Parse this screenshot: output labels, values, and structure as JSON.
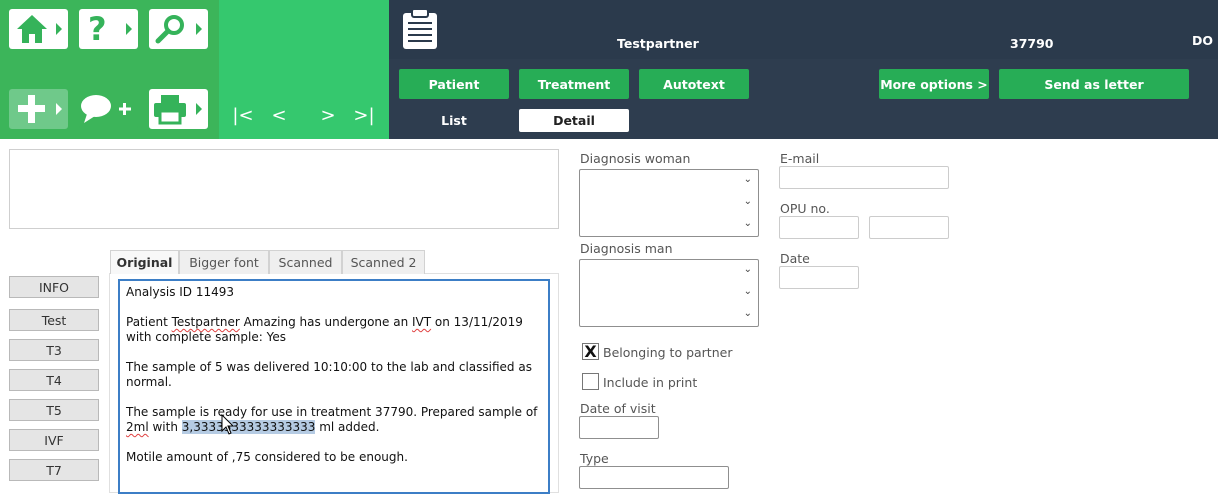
{
  "toolbar": {
    "home_icon": "home-icon",
    "help_icon": "question-icon",
    "search_icon": "magnifier-icon",
    "add_icon": "plus-icon",
    "comment_add_icon": "speech-bubble-plus-icon",
    "print_icon": "printer-icon",
    "clipboard_icon": "clipboard-icon",
    "nav": {
      "first": "|<",
      "prev": "<",
      "next": ">",
      "last": ">|"
    }
  },
  "header": {
    "partner_name": "Testpartner",
    "treatment_no": "37790",
    "user_initials": "DO"
  },
  "action_buttons": {
    "patient": "Patient",
    "treatment": "Treatment",
    "autotext": "Autotext",
    "more_options": "More options >",
    "send_as_letter": "Send as letter"
  },
  "view_tabs": {
    "list": "List",
    "detail": "Detail"
  },
  "side_buttons": [
    "INFO",
    "Test",
    "T3",
    "T4",
    "T5",
    "IVF",
    "T7"
  ],
  "doc_tabs": [
    "Original",
    "Bigger font",
    "Scanned",
    "Scanned 2"
  ],
  "editor": {
    "line1": "Analysis ID 11493",
    "p2_a": "Patient ",
    "p2_name": "Testpartner",
    "p2_b": " Amazing has undergone an ",
    "p2_ivt": "IVT",
    "p2_c": " on 13/11/2019 with complete sample: Yes",
    "p3": "The sample of 5 was delivered 10:10:00 to the lab and classified as normal.",
    "p4_a": "The sample is ready for use in treatment 37790. Prepared sample of ",
    "p4_ml": "2ml",
    "p4_b": " with ",
    "p4_sel": "3,3333333333333333",
    "p4_c": " ml added.",
    "p5": "Motile amount of ,75 considered to be enough."
  },
  "form": {
    "diagnosis_woman_label": "Diagnosis woman",
    "diagnosis_man_label": "Diagnosis man",
    "belonging_to_partner_label": "Belonging to partner",
    "belonging_to_partner_checked": true,
    "include_in_print_label": "Include in print",
    "include_in_print_checked": false,
    "date_of_visit_label": "Date of visit",
    "type_label": "Type",
    "email_label": "E-mail",
    "opu_label": "OPU no.",
    "date_label": "Date",
    "checkmark": "X"
  }
}
